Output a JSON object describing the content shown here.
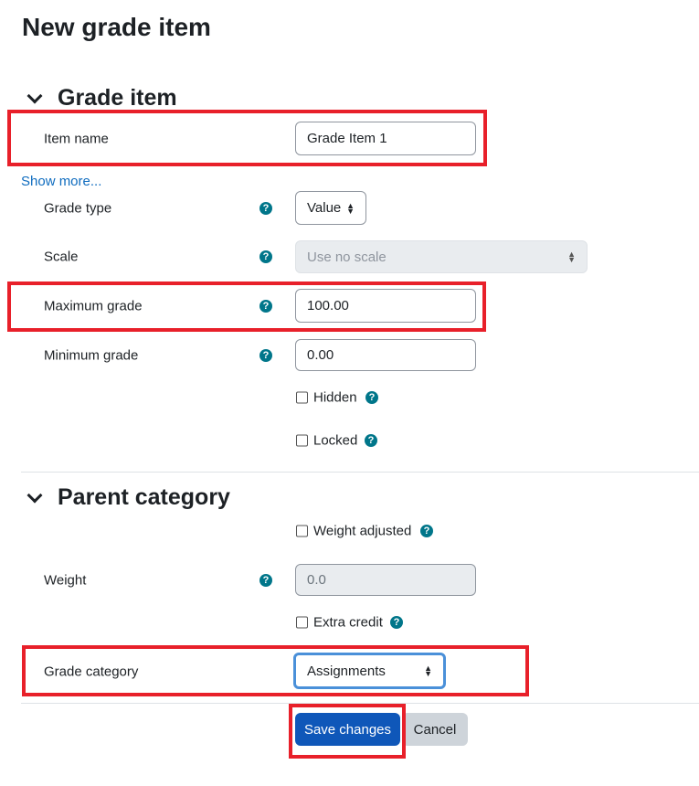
{
  "page_title": "New grade item",
  "sections": {
    "grade_item": {
      "title": "Grade item",
      "item_name": {
        "label": "Item name",
        "value": "Grade Item 1"
      },
      "show_more": "Show more...",
      "grade_type": {
        "label": "Grade type",
        "value": "Value"
      },
      "scale": {
        "label": "Scale",
        "value": "Use no scale"
      },
      "max_grade": {
        "label": "Maximum grade",
        "value": "100.00"
      },
      "min_grade": {
        "label": "Minimum grade",
        "value": "0.00"
      },
      "hidden": {
        "label": "Hidden",
        "checked": false
      },
      "locked": {
        "label": "Locked",
        "checked": false
      }
    },
    "parent_category": {
      "title": "Parent category",
      "weight_adjusted": {
        "label": "Weight adjusted",
        "checked": false
      },
      "weight": {
        "label": "Weight",
        "value": "0.0"
      },
      "extra_credit": {
        "label": "Extra credit",
        "checked": false
      },
      "grade_category": {
        "label": "Grade category",
        "value": "Assignments"
      }
    }
  },
  "buttons": {
    "save": "Save changes",
    "cancel": "Cancel"
  },
  "help_glyph": "?",
  "colors": {
    "highlight": "#e8202a",
    "primary": "#0f6cbf",
    "help": "#00768a"
  }
}
